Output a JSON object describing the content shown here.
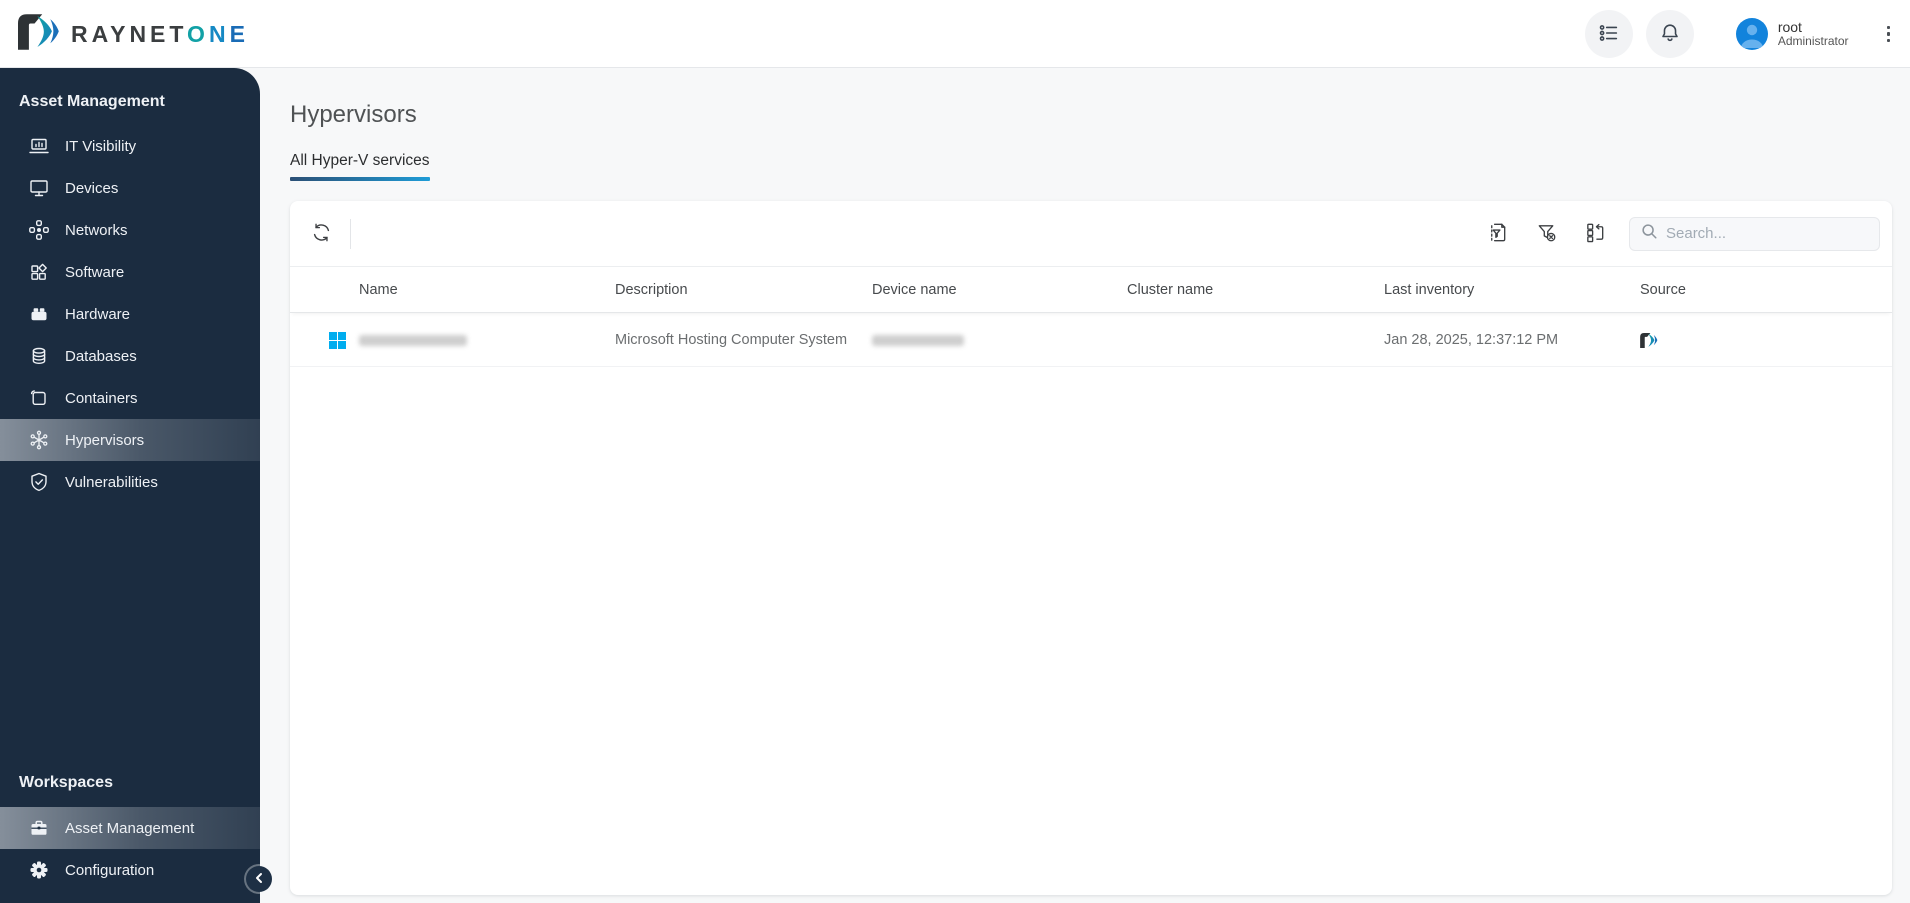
{
  "brand": {
    "name": "RAYNET",
    "suffix": [
      "O",
      "N",
      "E"
    ]
  },
  "topbar": {
    "user": {
      "name": "root",
      "role": "Administrator"
    },
    "icons": [
      "task-list-icon",
      "bell-icon",
      "user-avatar-icon",
      "kebab-menu-icon"
    ]
  },
  "sidebar": {
    "sections": [
      {
        "title": "Asset Management",
        "items": [
          {
            "label": "IT Visibility",
            "icon": "laptop-chart-icon",
            "active": false
          },
          {
            "label": "Devices",
            "icon": "monitor-icon",
            "active": false
          },
          {
            "label": "Networks",
            "icon": "network-icon",
            "active": false
          },
          {
            "label": "Software",
            "icon": "software-grid-icon",
            "active": false
          },
          {
            "label": "Hardware",
            "icon": "hardware-brick-icon",
            "active": false
          },
          {
            "label": "Databases",
            "icon": "database-icon",
            "active": false
          },
          {
            "label": "Containers",
            "icon": "container-icon",
            "active": false
          },
          {
            "label": "Hypervisors",
            "icon": "hypervisor-icon",
            "active": true
          },
          {
            "label": "Vulnerabilities",
            "icon": "shield-check-icon",
            "active": false
          }
        ]
      },
      {
        "title": "Workspaces",
        "items": [
          {
            "label": "Asset Management",
            "icon": "briefcase-icon",
            "active": true
          },
          {
            "label": "Configuration",
            "icon": "gear-icon",
            "active": false
          }
        ]
      }
    ],
    "collapse_icon": "chevron-left-icon"
  },
  "main": {
    "title": "Hypervisors",
    "tabs": [
      {
        "label": "All Hyper-V services",
        "active": true
      }
    ],
    "toolbar": {
      "search_placeholder": "Search...",
      "icons": [
        "refresh-icon",
        "filter-document-icon",
        "clear-filter-icon",
        "column-chooser-icon",
        "search-icon"
      ]
    },
    "table": {
      "columns": [
        "Name",
        "Description",
        "Device name",
        "Cluster name",
        "Last inventory",
        "Source"
      ],
      "rows": [
        {
          "name": "",
          "name_redacted": true,
          "name_icon": "windows-logo-icon",
          "description": "Microsoft Hosting Computer System",
          "device_name": "",
          "device_name_redacted": true,
          "cluster_name": "",
          "last_inventory": "Jan 28, 2025, 12:37:12 PM",
          "source_icon": "raynet-source-icon"
        }
      ]
    }
  },
  "colors": {
    "sidebar_bg": "#1b2c40",
    "accent_teal": "#12a1a6",
    "accent_blue": "#1a6cb6",
    "tab_underline_start": "#2b4f75",
    "tab_underline_end": "#1e9cd7",
    "windows_blue": "#00adef",
    "avatar_blue": "#1283dc",
    "logo_dark": "#2e3235"
  }
}
